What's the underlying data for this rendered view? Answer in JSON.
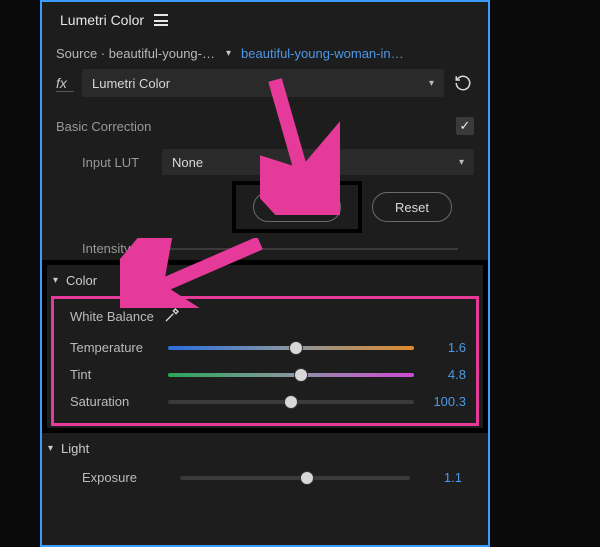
{
  "panel": {
    "title": "Lumetri Color",
    "source_prefix": "Source · ",
    "source_clip": "beautiful-young-w…",
    "target_clip": "beautiful-young-woman-in…",
    "effect_name": "Lumetri Color",
    "fx_label": "fx"
  },
  "basic": {
    "section_label": "Basic Correction",
    "input_lut_label": "Input LUT",
    "input_lut_value": "None",
    "auto_label": "Auto",
    "reset_label": "Reset",
    "intensity_label": "Intensity"
  },
  "color": {
    "header": "Color",
    "white_balance_label": "White Balance",
    "params": [
      {
        "label": "Temperature",
        "value": "1.6",
        "pos": 52,
        "track": "temperature"
      },
      {
        "label": "Tint",
        "value": "4.8",
        "pos": 54,
        "track": "tint"
      },
      {
        "label": "Saturation",
        "value": "100.3",
        "pos": 50,
        "track": "plain"
      }
    ]
  },
  "light": {
    "header": "Light",
    "params": [
      {
        "label": "Exposure",
        "value": "1.1",
        "pos": 55
      }
    ]
  },
  "colors": {
    "accent_blue": "#4e98e8",
    "highlight_pink": "#e63a9a"
  }
}
